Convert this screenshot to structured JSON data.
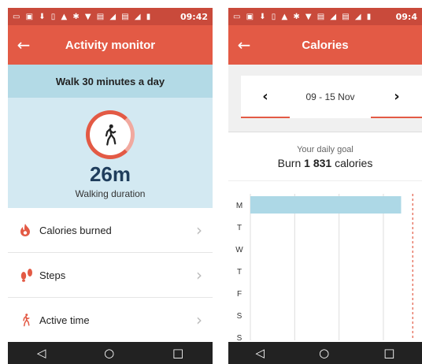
{
  "status_bar": {
    "icons": "▭ ▣ ⬇ ▯ ▲ ✱ ▼ ▤ ◢ ▤ ◢ ▮",
    "time": "09:42",
    "time_right": "09:4"
  },
  "left_screen": {
    "app_bar": {
      "back": "←",
      "title": "Activity monitor"
    },
    "goal_banner": "Walk 30 minutes a day",
    "duration_value": "26m",
    "duration_label": "Walking duration",
    "menu": [
      {
        "label": "Calories burned",
        "icon": "flame-icon"
      },
      {
        "label": "Steps",
        "icon": "footprints-icon"
      },
      {
        "label": "Active time",
        "icon": "walking-person-icon"
      }
    ]
  },
  "right_screen": {
    "app_bar": {
      "back": "←",
      "title": "Calories"
    },
    "date_range": "09 - 15 Nov",
    "prev": "‹",
    "next": "›",
    "daily_goal_label": "Your daily goal",
    "daily_goal_prefix": "Burn ",
    "daily_goal_value": "1 831",
    "daily_goal_suffix": " calories"
  },
  "nav": {
    "back": "◁",
    "home": "○",
    "recent": "□"
  },
  "colors": {
    "status": "#c94a3b",
    "appbar": "#e35a45",
    "summary_bg": "#d3e9f2",
    "banner_bg": "#b3dae6",
    "bar": "#add8e6",
    "goal_line": "#e35a45"
  },
  "chart_data": {
    "type": "bar",
    "orientation": "horizontal",
    "categories": [
      "M",
      "T",
      "W",
      "T",
      "F",
      "S",
      "S"
    ],
    "values": [
      1700,
      0,
      0,
      0,
      0,
      0,
      0
    ],
    "goal": 1831,
    "xlim": [
      0,
      1900
    ],
    "grid": true
  }
}
